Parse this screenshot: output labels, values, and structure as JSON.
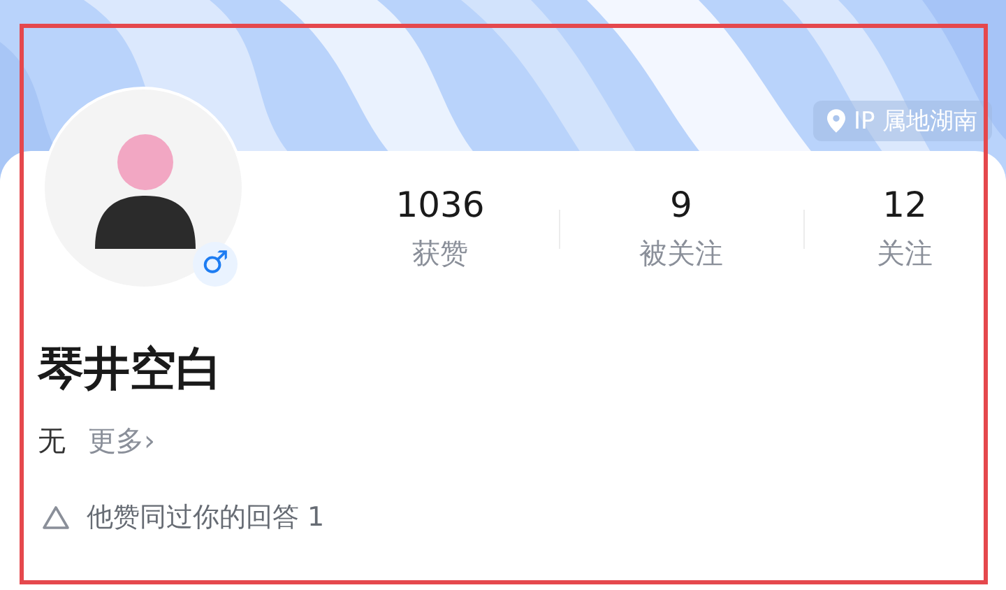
{
  "ip_location": "IP 属地湖南",
  "avatar": {
    "gender_symbol": "♂"
  },
  "stats": [
    {
      "value": "1036",
      "label": "获赞"
    },
    {
      "value": "9",
      "label": "被关注"
    },
    {
      "value": "12",
      "label": "关注"
    }
  ],
  "name": "琴井空白",
  "bio": "无",
  "more_link": "更多›",
  "upvote_note": "他赞同过你的回答 1"
}
